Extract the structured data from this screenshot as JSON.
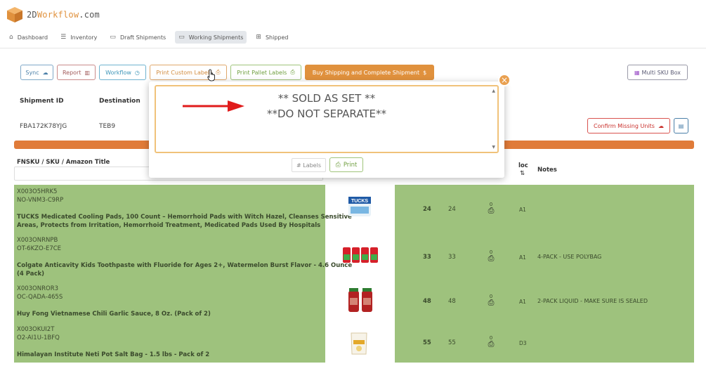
{
  "app": {
    "logo_prefix": "2D",
    "logo_accent": "Workflow",
    "logo_suffix": ".com",
    "accent_color": "#e0913d"
  },
  "nav": [
    {
      "label": "Dashboard",
      "icon": "home-icon"
    },
    {
      "label": "Inventory",
      "icon": "list-icon"
    },
    {
      "label": "Draft Shipments",
      "icon": "document-icon"
    },
    {
      "label": "Working Shipments",
      "icon": "monitor-icon"
    },
    {
      "label": "Shipped",
      "icon": "grid-icon"
    }
  ],
  "toolbar": {
    "sync": "Sync",
    "report": "Report",
    "workflow": "Workflow",
    "print_custom": "Print Custom Labels",
    "print_pallet": "Print Pallet Labels",
    "buy_shipping": "Buy Shipping and Complete Shipment",
    "multi_sku": "Multi SKU Box",
    "confirm_missing": "Confirm Missing Units"
  },
  "shipment": {
    "id_label": "Shipment ID",
    "dest_label": "Destination",
    "id": "FBA172K78YJG",
    "destination": "TEB9"
  },
  "table": {
    "col_title": "FNSKU / SKU / Amazon Title",
    "col_loc": "loc",
    "col_loc_sort": "⇅",
    "col_notes": "Notes"
  },
  "rows": [
    {
      "fnsku": "X003O5HRK5",
      "sku": "NO-VNM3-C9RP",
      "title_1": "TUCKS Medicated Cooling Pads, 100 Count – Hemorrhoid Pads with Witch Hazel, Cleanses Sensitive",
      "title_2": "Areas, Protects from Irritation, Hemorrhoid Treatment, Medicated Pads Used By Hospitals",
      "qty_bold": "24",
      "qty": "24",
      "printed": "0",
      "loc": "A1",
      "note": ""
    },
    {
      "fnsku": "X003ONRNPB",
      "sku": "OT-6KZO-E7CE",
      "title_1": "Colgate Anticavity Kids Toothpaste with Fluoride for Ages 2+, Watermelon Burst Flavor - 4.6 Ounce",
      "title_2": "(4 Pack)",
      "qty_bold": "33",
      "qty": "33",
      "printed": "0",
      "loc": "A1",
      "note": "4-PACK - USE POLYBAG"
    },
    {
      "fnsku": "X003ONROR3",
      "sku": "OC-QADA-465S",
      "title_1": "Huy Fong Vietnamese Chili Garlic Sauce, 8 Oz. (Pack of 2)",
      "title_2": "",
      "qty_bold": "48",
      "qty": "48",
      "printed": "0",
      "loc": "A1",
      "note": "2-PACK LIQUID - MAKE SURE IS SEALED"
    },
    {
      "fnsku": "X003OKUI2T",
      "sku": "O2-AI1U-1BFQ",
      "title_1": "Himalayan Institute Neti Pot Salt Bag - 1.5 lbs - Pack of 2",
      "title_2": "",
      "qty_bold": "55",
      "qty": "55",
      "printed": "0",
      "loc": "D3",
      "note": ""
    }
  ],
  "popup": {
    "line1": "** SOLD AS SET **",
    "line2": "**DO NOT SEPARATE**",
    "labels_placeholder": "# Labels",
    "print": "Print"
  },
  "product_images": {
    "row1": "TUCKS"
  }
}
